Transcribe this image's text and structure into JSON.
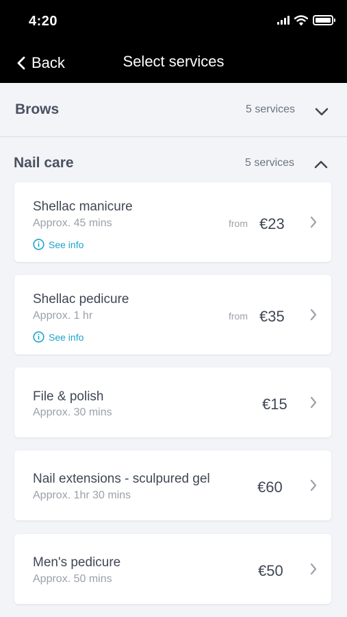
{
  "status_bar": {
    "time": "4:20"
  },
  "header": {
    "back_label": "Back",
    "title": "Select services"
  },
  "sections": [
    {
      "title": "Brows",
      "count": "5 services",
      "state": "collapsed"
    },
    {
      "title": "Nail care",
      "count": "5 services",
      "state": "expanded"
    }
  ],
  "services": [
    {
      "name": "Shellac manicure",
      "duration": "Approx. 45 mins",
      "from": "from",
      "price": "€23",
      "info": "See info"
    },
    {
      "name": "Shellac pedicure",
      "duration": "Approx. 1 hr",
      "from": "from",
      "price": "€35",
      "info": "See info"
    },
    {
      "name": "File & polish",
      "duration": "Approx. 30 mins",
      "price": "€15"
    },
    {
      "name": "Nail extensions - sculpured gel",
      "duration": "Approx. 1hr 30 mins",
      "price": "€60"
    },
    {
      "name": "Men's pedicure",
      "duration": "Approx. 50 mins",
      "price": "€50"
    }
  ],
  "colors": {
    "header_bg": "#000000",
    "page_bg": "#f2f4f8",
    "accent": "#1aa3c9",
    "text": "#3f4654",
    "muted": "#9aa0aa"
  }
}
